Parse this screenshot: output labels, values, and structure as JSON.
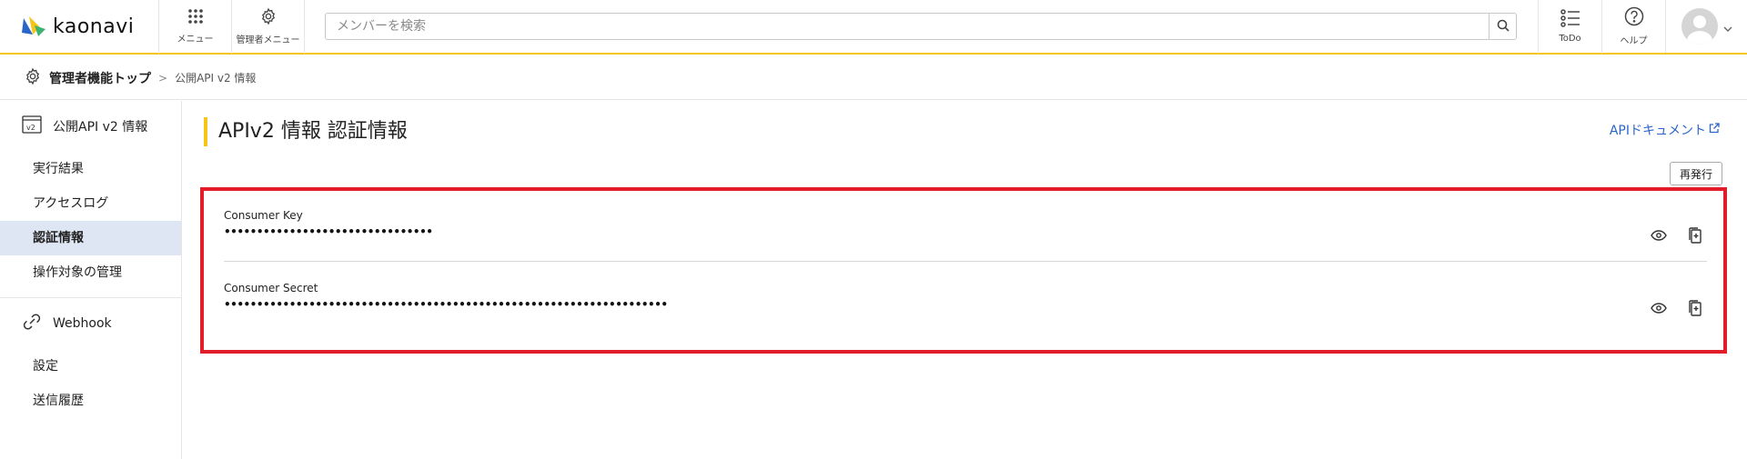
{
  "brand": {
    "logo_text": "kaonavi",
    "accent": "#f5c518",
    "link_color": "#2a66c9",
    "highlight_border": "#e21d2a"
  },
  "header": {
    "menu_label": "メニュー",
    "admin_menu_label": "管理者メニュー",
    "search_placeholder": "メンバーを検索",
    "todo_label": "ToDo",
    "help_label": "ヘルプ"
  },
  "breadcrumb": {
    "root": "管理者機能トップ",
    "separator": ">",
    "current": "公開API v2 情報"
  },
  "sidebar": {
    "sections": [
      {
        "title": "公開API v2 情報",
        "icon": "api-v2-icon",
        "items": [
          {
            "label": "実行結果",
            "active": false
          },
          {
            "label": "アクセスログ",
            "active": false
          },
          {
            "label": "認証情報",
            "active": true
          },
          {
            "label": "操作対象の管理",
            "active": false
          }
        ]
      },
      {
        "title": "Webhook",
        "icon": "link-icon",
        "items": [
          {
            "label": "設定",
            "active": false
          },
          {
            "label": "送信履歴",
            "active": false
          }
        ]
      }
    ]
  },
  "main": {
    "title": "APIv2 情報 認証情報",
    "doc_link": "APIドキュメント",
    "reissue_label": "再発行",
    "credentials": [
      {
        "label": "Consumer Key",
        "value": "••••••••••••••••••••••••••••••••"
      },
      {
        "label": "Consumer Secret",
        "value": "••••••••••••••••••••••••••••••••••••••••••••••••••••••••••••••••••••"
      }
    ]
  }
}
